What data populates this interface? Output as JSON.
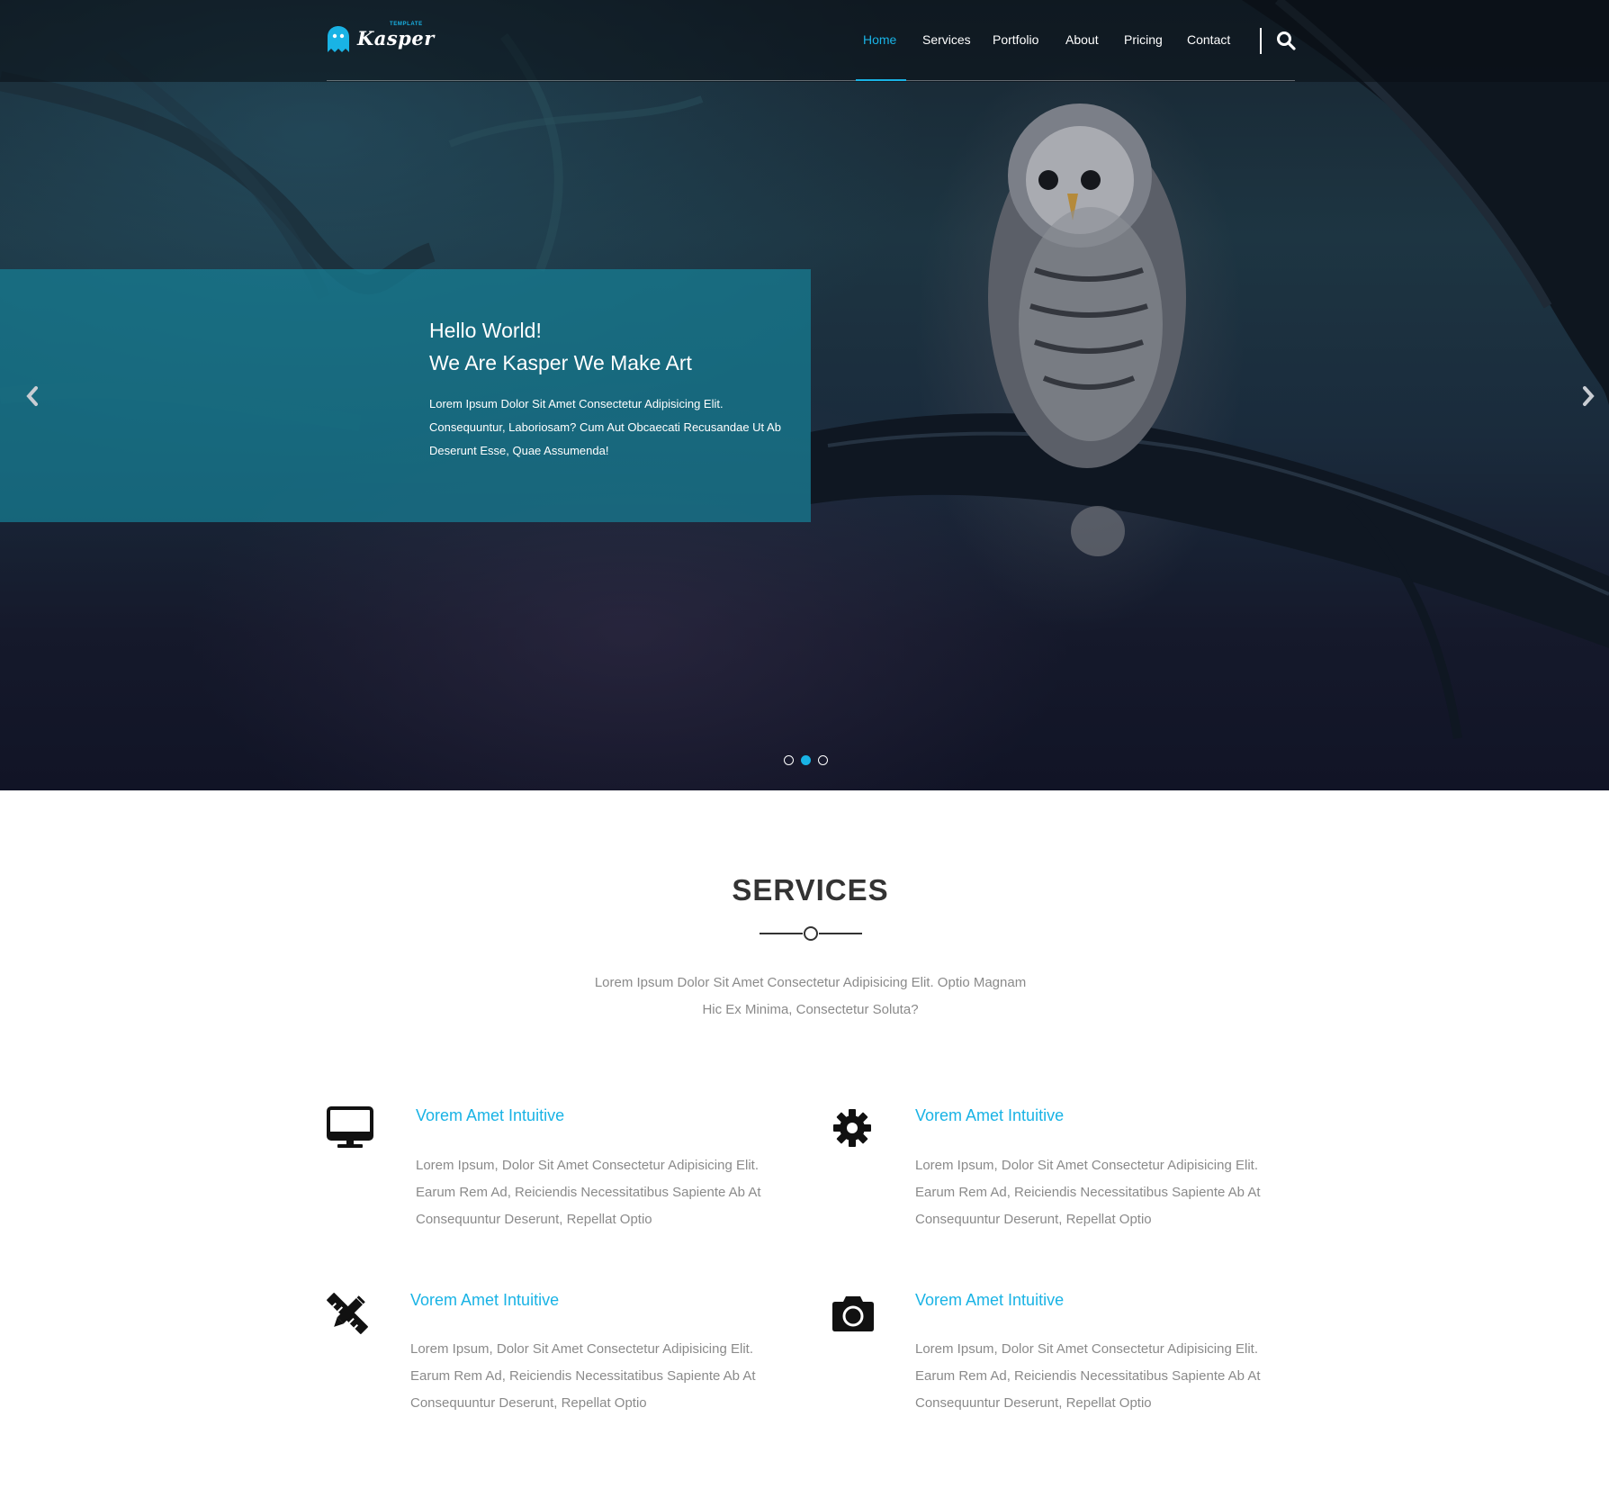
{
  "brand": {
    "name": "Kasper",
    "tagline": "TEMPLATE",
    "accent_color": "#19b3e5"
  },
  "nav": {
    "items": [
      {
        "label": "Home",
        "active": true
      },
      {
        "label": "Services",
        "active": false
      },
      {
        "label": "Portfolio",
        "active": false
      },
      {
        "label": "About",
        "active": false
      },
      {
        "label": "Pricing",
        "active": false
      },
      {
        "label": "Contact",
        "active": false
      }
    ],
    "search_icon": "search-icon"
  },
  "hero": {
    "title_line1": "Hello World!",
    "title_line2": "We Are Kasper We Make Art",
    "text": "Lorem Ipsum Dolor Sit Amet Consectetur Adipisicing Elit. Consequuntur, Laboriosam? Cum Aut Obcaecati Recusandae Ut Ab Deserunt Esse, Quae Assumenda!",
    "slides_count": 3,
    "active_slide": 2,
    "prev_icon": "chevron-left-icon",
    "next_icon": "chevron-right-icon"
  },
  "services": {
    "title": "SERVICES",
    "intro_line1": "Lorem Ipsum Dolor Sit Amet Consectetur Adipisicing Elit. Optio Magnam",
    "intro_line2": "Hic Ex Minima, Consectetur Soluta?",
    "items": [
      {
        "icon": "desktop-icon",
        "title": "Vorem Amet Intuitive",
        "line1": "Lorem Ipsum, Dolor Sit Amet Consectetur Adipisicing Elit.",
        "line2": "Earum Rem Ad, Reiciendis Necessitatibus Sapiente Ab At",
        "line3": "Consequuntur Deserunt, Repellat Optio"
      },
      {
        "icon": "gear-icon",
        "title": "Vorem Amet Intuitive",
        "line1": "Lorem Ipsum, Dolor Sit Amet Consectetur Adipisicing Elit.",
        "line2": "Earum Rem Ad, Reiciendis Necessitatibus Sapiente Ab At",
        "line3": "Consequuntur Deserunt, Repellat Optio"
      },
      {
        "icon": "pencil-ruler-icon",
        "title": "Vorem Amet Intuitive",
        "line1": "Lorem Ipsum, Dolor Sit Amet Consectetur Adipisicing Elit.",
        "line2": "Earum Rem Ad, Reiciendis Necessitatibus Sapiente Ab At",
        "line3": "Consequuntur Deserunt, Repellat Optio"
      },
      {
        "icon": "camera-icon",
        "title": "Vorem Amet Intuitive",
        "line1": "Lorem Ipsum, Dolor Sit Amet Consectetur Adipisicing Elit.",
        "line2": "Earum Rem Ad, Reiciendis Necessitatibus Sapiente Ab At",
        "line3": "Consequuntur Deserunt, Repellat Optio"
      }
    ]
  }
}
